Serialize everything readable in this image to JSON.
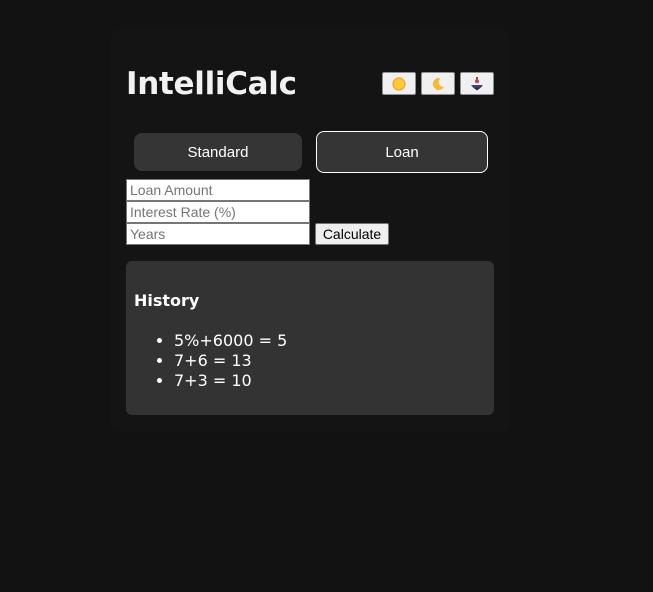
{
  "app": {
    "title": "IntelliCalc"
  },
  "theme_buttons": [
    {
      "icon": "sun-icon",
      "label": "light theme"
    },
    {
      "icon": "moon-icon",
      "label": "dark theme"
    },
    {
      "icon": "spinning-top-icon",
      "label": "custom theme"
    }
  ],
  "modes": {
    "standard_label": "Standard",
    "loan_label": "Loan",
    "active": "Loan"
  },
  "loan_form": {
    "amount_placeholder": "Loan Amount",
    "rate_placeholder": "Interest Rate (%)",
    "years_placeholder": "Years",
    "calculate_label": "Calculate"
  },
  "history": {
    "heading": "History",
    "items": [
      "5%+6000 = 5",
      "7+6 = 13",
      "7+3 = 10"
    ]
  },
  "colors": {
    "background": "#121212",
    "panel": "#333333",
    "mode_button": "#353535",
    "text": "#ffffff"
  }
}
